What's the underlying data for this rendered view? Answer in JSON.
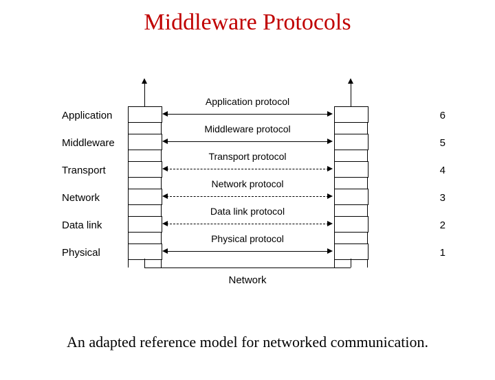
{
  "title": "Middleware Protocols",
  "caption": "An adapted reference model for networked communication.",
  "layers": [
    {
      "name": "Application",
      "protocol": "Application protocol",
      "num": "6"
    },
    {
      "name": "Middleware",
      "protocol": "Middleware protocol",
      "num": "5"
    },
    {
      "name": "Transport",
      "protocol": "Transport protocol",
      "num": "4"
    },
    {
      "name": "Network",
      "protocol": "Network protocol",
      "num": "3"
    },
    {
      "name": "Data link",
      "protocol": "Data link protocol",
      "num": "2"
    },
    {
      "name": "Physical",
      "protocol": "Physical protocol",
      "num": "1"
    }
  ],
  "networkLabel": "Network"
}
